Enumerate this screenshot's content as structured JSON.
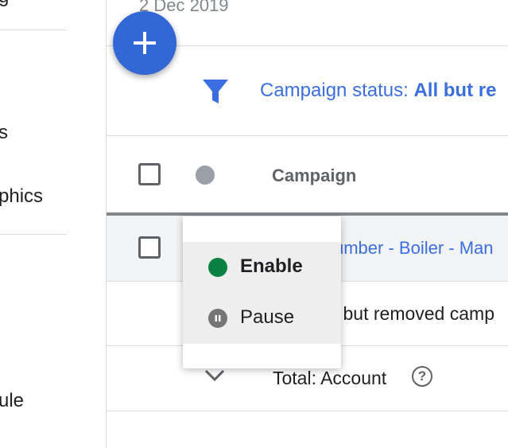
{
  "sidebar": {
    "items": [
      {
        "label": "g"
      },
      {
        "label": "s"
      },
      {
        "label": "phics"
      },
      {
        "label": "ule"
      }
    ]
  },
  "header": {
    "date_range": "2 Dec 2019",
    "add_button_label": "+"
  },
  "filter": {
    "prefix": "Campaign status: ",
    "value": "All but re"
  },
  "table": {
    "columns": {
      "campaign": "Campaign"
    },
    "rows": [
      {
        "campaign_name": "umber - Boiler - Man"
      },
      {
        "campaign_name": "l but removed camp"
      }
    ],
    "total_label": "Total: Account",
    "help_icon_glyph": "?"
  },
  "status_menu": {
    "items": [
      {
        "label": "Enable",
        "icon": "enabled-dot-icon",
        "color": "#0b8043"
      },
      {
        "label": "Pause",
        "icon": "pause-icon",
        "color": "#757575"
      }
    ]
  },
  "colors": {
    "accent": "#3367d6",
    "link": "#3b6ee0"
  }
}
